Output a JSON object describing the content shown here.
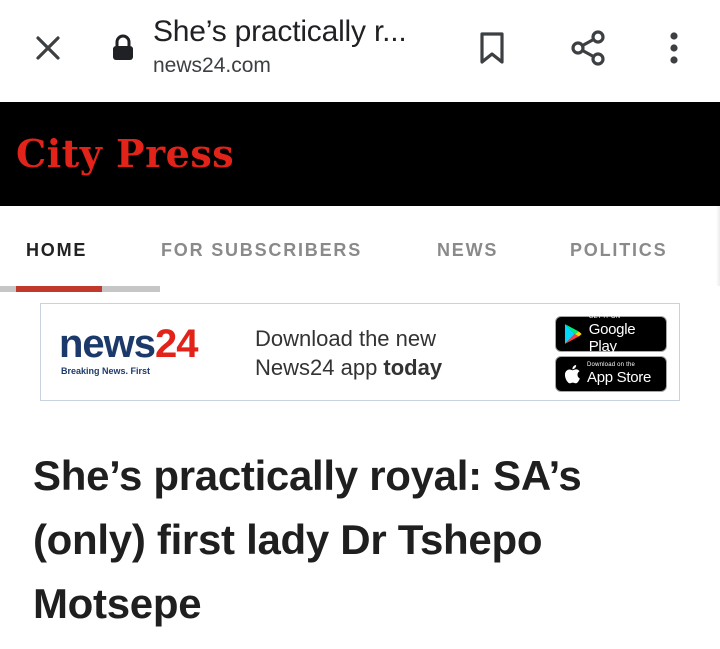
{
  "browser": {
    "page_title": "She’s practically r...",
    "domain": "news24.com",
    "icons": {
      "close": "close-icon",
      "lock": "lock-icon",
      "bookmark": "bookmark-icon",
      "share": "share-icon",
      "menu": "more-vertical-icon"
    }
  },
  "masthead": {
    "brand": "City Press",
    "brand_color": "#e2231a",
    "background": "#000000"
  },
  "nav": {
    "items": [
      {
        "label": "HOME",
        "active": true
      },
      {
        "label": "FOR SUBSCRIBERS",
        "active": false
      },
      {
        "label": "NEWS",
        "active": false
      },
      {
        "label": "POLITICS",
        "active": false
      }
    ],
    "indicator_color": "#c0392b"
  },
  "ad": {
    "logo_word": "news",
    "logo_number": "24",
    "tagline": "Breaking News. First",
    "line1": "Download the new",
    "line2_prefix": "News24 app ",
    "line2_bold": "today",
    "google_play": {
      "small": "GET IT ON",
      "big": "Google Play"
    },
    "app_store": {
      "small": "Download on the",
      "big": "App Store"
    }
  },
  "article": {
    "headline": "She’s practically royal: SA’s (only) first lady Dr Tshepo Motsepe"
  }
}
